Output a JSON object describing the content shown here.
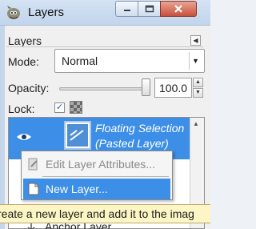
{
  "window": {
    "title": "Layers",
    "controls": [
      "minimize",
      "maximize",
      "close"
    ]
  },
  "panel": {
    "tab_label": "Layers",
    "mode_label": "Mode:",
    "mode_value": "Normal",
    "opacity_label": "Opacity:",
    "opacity_value": "100.0",
    "opacity_percent": 100,
    "lock_label": "Lock:",
    "lock_pixels_checked": true
  },
  "layers": {
    "selected_layer_name": "Floating Selection\n(Pasted Layer)",
    "selected_layer_visible": true
  },
  "context_menu": {
    "items": [
      {
        "label": "Edit Layer Attributes...",
        "enabled": false,
        "icon": "edit-layer-icon"
      },
      {
        "label": "New Layer...",
        "enabled": true,
        "highlighted": true,
        "icon": "new-layer-icon"
      }
    ]
  },
  "tooltip": {
    "text": "reate a new layer and add it to the imag"
  },
  "partial_row": {
    "label": "Anchor Layer",
    "icon": "anchor-icon"
  },
  "colors": {
    "selection": "#3c8ee6",
    "tooltip_bg": "#fdf5c3",
    "titlebar": "#c2d5ec"
  }
}
